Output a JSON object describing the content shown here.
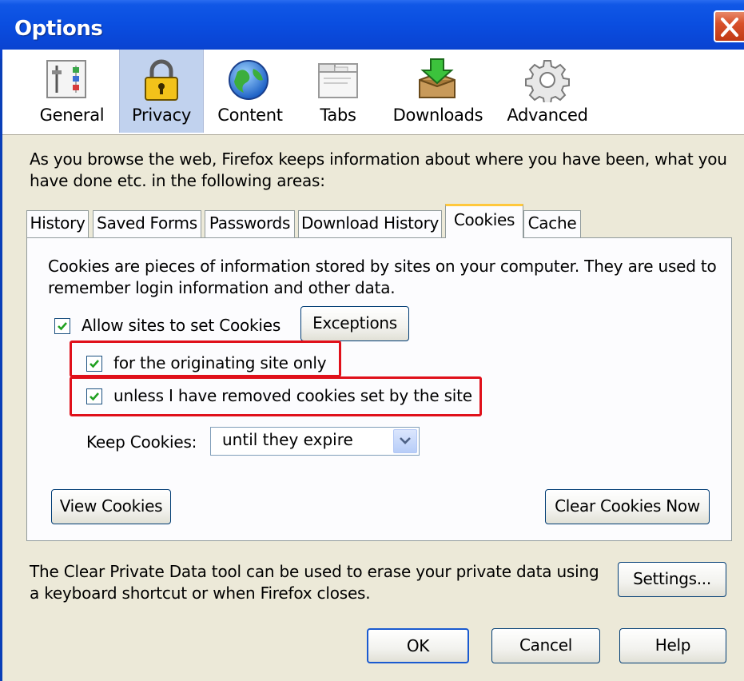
{
  "window": {
    "title": "Options"
  },
  "toolbar": {
    "items": [
      {
        "label": "General",
        "icon": "general-sliders-icon"
      },
      {
        "label": "Privacy",
        "icon": "padlock-icon",
        "selected": true
      },
      {
        "label": "Content",
        "icon": "globe-icon"
      },
      {
        "label": "Tabs",
        "icon": "tabs-window-icon"
      },
      {
        "label": "Downloads",
        "icon": "download-box-icon"
      },
      {
        "label": "Advanced",
        "icon": "gear-icon"
      }
    ]
  },
  "privacy": {
    "intro": "As you browse the web, Firefox keeps information about where you have been, what you have done etc. in the following areas:",
    "tabs": [
      "History",
      "Saved Forms",
      "Passwords",
      "Download History",
      "Cookies",
      "Cache"
    ],
    "selected_tab": "Cookies",
    "cookies": {
      "description": "Cookies are pieces of information stored by sites on your computer. They are used to remember login information and other data.",
      "allow_label": "Allow sites to set Cookies",
      "allow_checked": true,
      "exceptions_button": "Exceptions",
      "originating_label": "for the originating site only",
      "originating_checked": true,
      "unless_label": "unless I have removed cookies set by the site",
      "unless_checked": true,
      "keep_label": "Keep Cookies:",
      "keep_value": "until they expire",
      "view_button": "View Cookies",
      "clear_button": "Clear Cookies Now"
    },
    "clear_private": {
      "text": "The Clear Private Data tool can be used to erase your private data using a keyboard shortcut or when Firefox closes.",
      "settings_button": "Settings..."
    }
  },
  "footer": {
    "ok": "OK",
    "cancel": "Cancel",
    "help": "Help"
  },
  "colors": {
    "title_bar": "#0a4ee0",
    "highlight_box": "#e0101a",
    "selected_tab_accent": "#ffc83c"
  }
}
